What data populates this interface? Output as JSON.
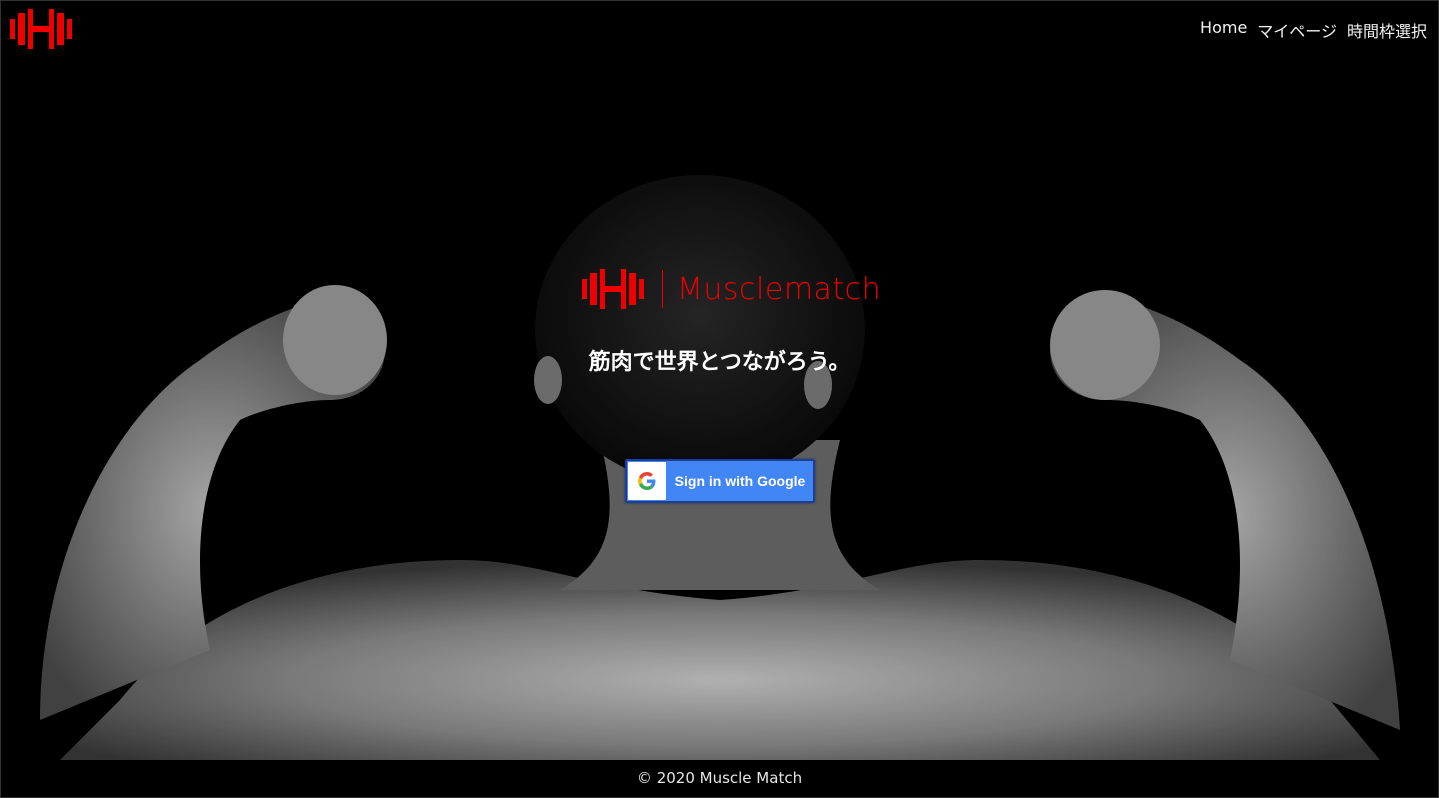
{
  "header": {
    "logo_icon": "dumbbell-icon",
    "nav": [
      "Home",
      "マイページ",
      "時間枠選択"
    ]
  },
  "hero": {
    "brand_name": "Musclematch",
    "tagline": "筋肉で世界とつながろう。",
    "signin_label": "Sign in with Google",
    "signin_icon": "google-g-icon"
  },
  "footer": {
    "copyright": "© 2020 Muscle Match"
  },
  "colors": {
    "brand_red": "#ee0000",
    "google_blue": "#4285f4",
    "background": "#000000"
  }
}
